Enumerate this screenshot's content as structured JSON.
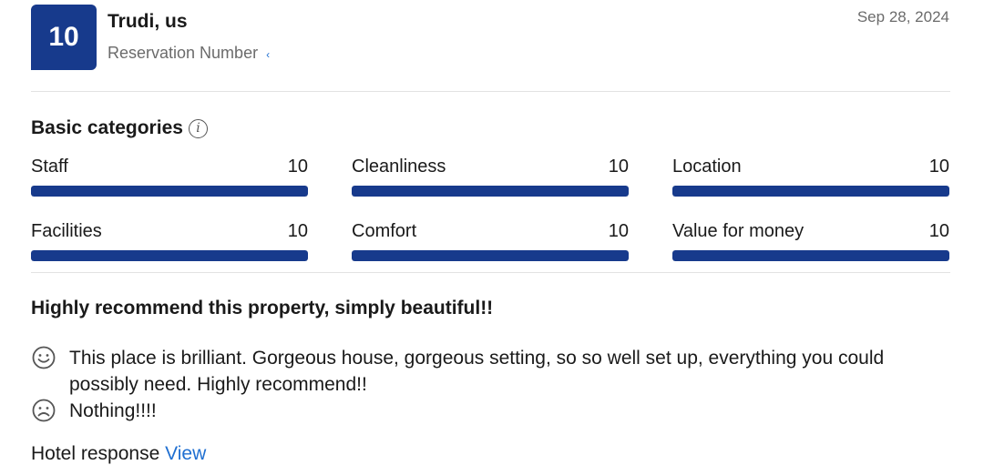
{
  "review": {
    "score": "10",
    "reviewer": "Trudi, us",
    "reservation_label": "Reservation Number",
    "reservation_link_glyph": "‹",
    "date": "Sep 28, 2024",
    "title": "Highly recommend this property, simply beautiful!!",
    "positive": "This place is brilliant. Gorgeous house, gorgeous setting, so so well set up, everything you could possibly need. Highly recommend!!",
    "negative": "Nothing!!!!"
  },
  "categories_section": {
    "title": "Basic categories",
    "info_icon": "info-icon",
    "items": [
      {
        "label": "Staff",
        "score": "10",
        "fraction": 1.0
      },
      {
        "label": "Cleanliness",
        "score": "10",
        "fraction": 1.0
      },
      {
        "label": "Location",
        "score": "10",
        "fraction": 1.0
      },
      {
        "label": "Facilities",
        "score": "10",
        "fraction": 1.0
      },
      {
        "label": "Comfort",
        "score": "10",
        "fraction": 1.0
      },
      {
        "label": "Value for money",
        "score": "10",
        "fraction": 1.0
      }
    ]
  },
  "footer_cut": {
    "text": "Hotel response",
    "link": "View"
  },
  "colors": {
    "accent": "#173a8c",
    "link": "#1f6fd1",
    "muted": "#6b6b6b"
  }
}
